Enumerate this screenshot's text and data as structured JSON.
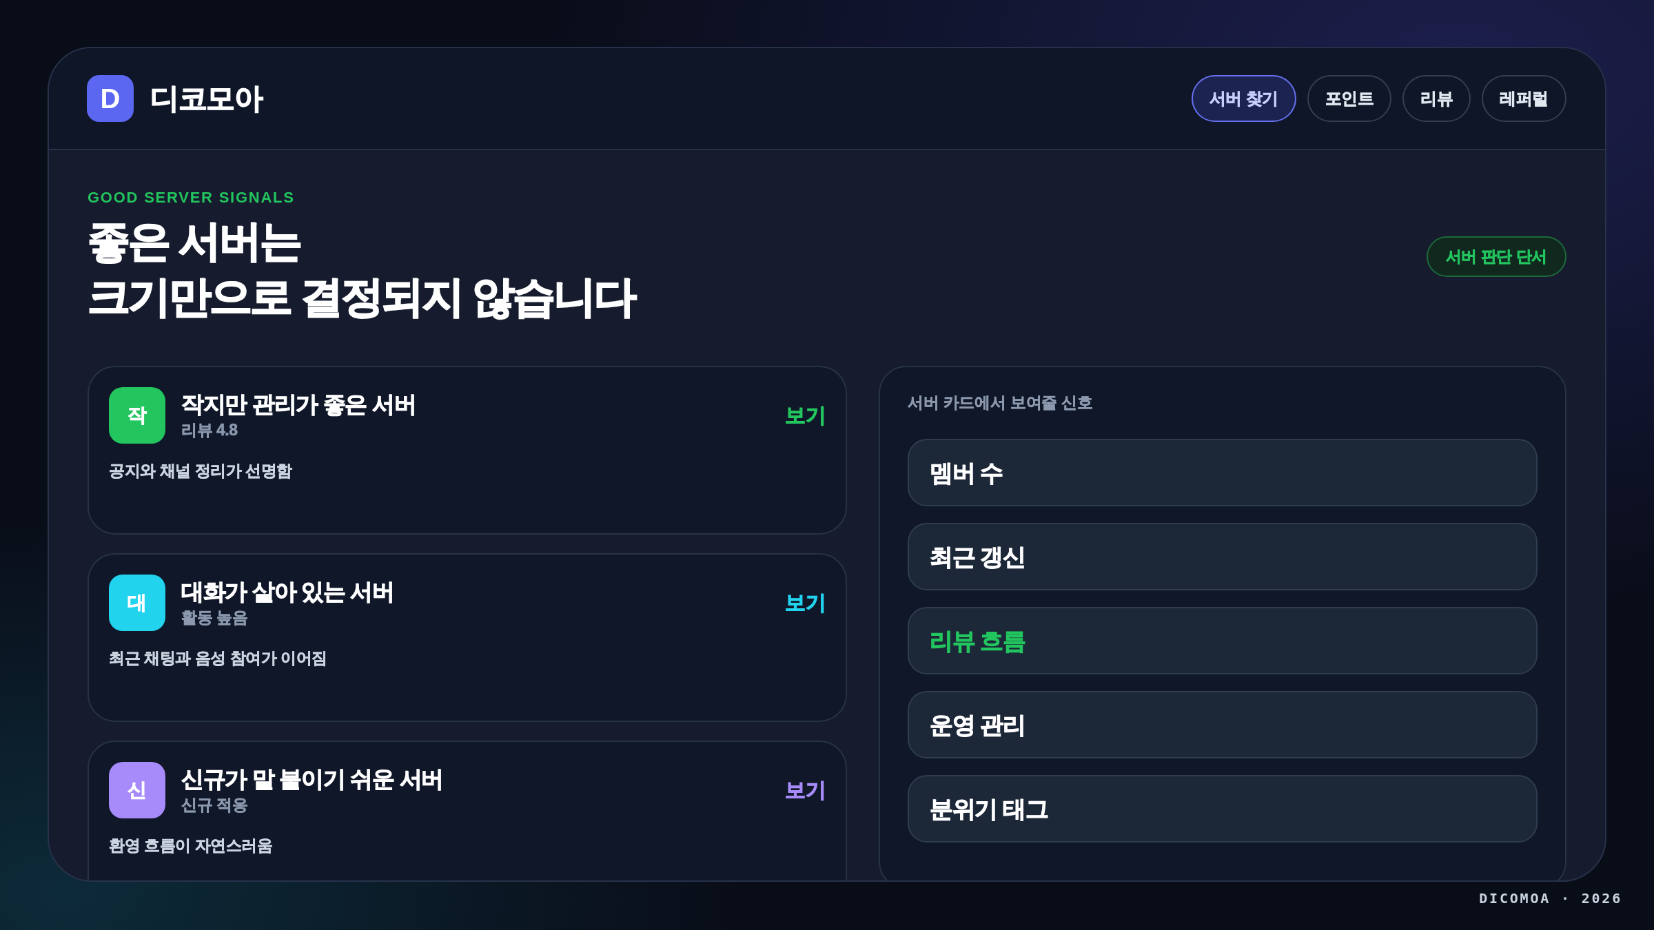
{
  "brand": {
    "logo_letter": "D",
    "name": "디코모아"
  },
  "nav": [
    {
      "label": "서버 찾기",
      "selected": true
    },
    {
      "label": "포인트",
      "selected": false
    },
    {
      "label": "리뷰",
      "selected": false
    },
    {
      "label": "레퍼럴",
      "selected": false
    }
  ],
  "hero": {
    "eyebrow": "GOOD SERVER SIGNALS",
    "heading_lines": [
      "좋은 서버는",
      "크기만으로 결정되지 않습니다"
    ],
    "badge": "서버 판단 단서"
  },
  "server_cards": [
    {
      "initial": "작",
      "title": "작지만 관리가 좋은 서버",
      "meta": "리뷰 4.8",
      "description": "공지와 채널 정리가 선명함",
      "link": "보기",
      "color": "#22c55e"
    },
    {
      "initial": "대",
      "title": "대화가 살아 있는 서버",
      "meta": "활동 높음",
      "description": "최근 채팅과 음성 참여가 이어짐",
      "link": "보기",
      "color": "#22d3ee"
    },
    {
      "initial": "신",
      "title": "신규가 말 붙이기 쉬운 서버",
      "meta": "신규 적응",
      "description": "환영 흐름이 자연스러움",
      "link": "보기",
      "color": "#a78bfa"
    }
  ],
  "signals_panel": {
    "label": "서버 카드에서 보여줄 신호",
    "items": [
      {
        "label": "멤버 수",
        "highlighted": false
      },
      {
        "label": "최근 갱신",
        "highlighted": false
      },
      {
        "label": "리뷰 흐름",
        "highlighted": true
      },
      {
        "label": "운영 관리",
        "highlighted": false
      },
      {
        "label": "분위기 태그",
        "highlighted": false
      }
    ]
  },
  "footer": "DICOMOA · 2026"
}
